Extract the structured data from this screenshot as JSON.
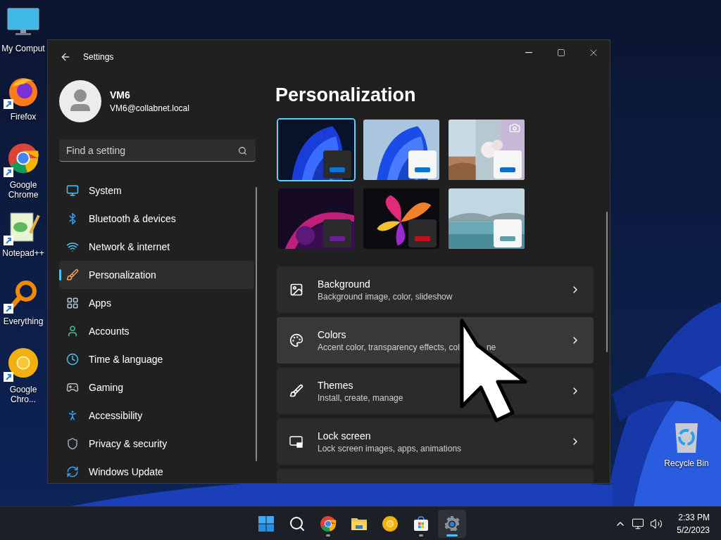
{
  "desktop": {
    "shortcuts": [
      {
        "label": "My Comput",
        "shortcut": false
      },
      {
        "label": "Firefox",
        "shortcut": true
      },
      {
        "label": "Google Chrome",
        "shortcut": true
      },
      {
        "label": "Notepad++",
        "shortcut": true
      },
      {
        "label": "Everything",
        "shortcut": true
      },
      {
        "label": "Google Chro...",
        "shortcut": true
      }
    ],
    "recycle_bin": {
      "label": "Recycle Bin"
    }
  },
  "window": {
    "title": "Settings"
  },
  "account": {
    "name": "VM6",
    "email": "VM6@collabnet.local"
  },
  "search": {
    "placeholder": "Find a setting"
  },
  "nav": [
    {
      "label": "System",
      "selected": false
    },
    {
      "label": "Bluetooth & devices",
      "selected": false
    },
    {
      "label": "Network & internet",
      "selected": false
    },
    {
      "label": "Personalization",
      "selected": true
    },
    {
      "label": "Apps",
      "selected": false
    },
    {
      "label": "Accounts",
      "selected": false
    },
    {
      "label": "Time & language",
      "selected": false
    },
    {
      "label": "Gaming",
      "selected": false
    },
    {
      "label": "Accessibility",
      "selected": false
    },
    {
      "label": "Privacy & security",
      "selected": false
    },
    {
      "label": "Windows Update",
      "selected": false
    }
  ],
  "page_title": "Personalization",
  "themes": [
    {
      "kind": "bloom-dark",
      "dark": true,
      "color": "#0a74d4",
      "selected": true
    },
    {
      "kind": "bloom-light",
      "dark": false,
      "color": "#0a74d4",
      "selected": false
    },
    {
      "kind": "spotlight",
      "dark": false,
      "color": "#0a6ccc",
      "selected": false
    },
    {
      "kind": "glow",
      "dark": true,
      "color": "#6b1e9e",
      "selected": false
    },
    {
      "kind": "flower",
      "dark": true,
      "color": "#c4101c",
      "selected": false
    },
    {
      "kind": "lake",
      "dark": false,
      "color": "#5f9ea8",
      "selected": false
    }
  ],
  "settings": [
    {
      "title": "Background",
      "description": "Background image, color, slideshow",
      "hovered": false
    },
    {
      "title": "Colors",
      "description": "Accent color, transparency effects, col",
      "description_tail": "ne",
      "hovered": true
    },
    {
      "title": "Themes",
      "description": "Install, create, manage",
      "hovered": false
    },
    {
      "title": "Lock screen",
      "description": "Lock screen images, apps, animations",
      "hovered": false
    }
  ],
  "taskbar": {
    "apps": [
      {
        "running": false,
        "selected": false
      },
      {
        "running": false,
        "selected": false
      },
      {
        "running": true,
        "selected": false
      },
      {
        "running": false,
        "selected": false
      },
      {
        "running": false,
        "selected": false
      },
      {
        "running": true,
        "selected": false
      },
      {
        "running": true,
        "selected": true
      }
    ],
    "time": "2:33 PM",
    "date": "5/2/2023"
  }
}
